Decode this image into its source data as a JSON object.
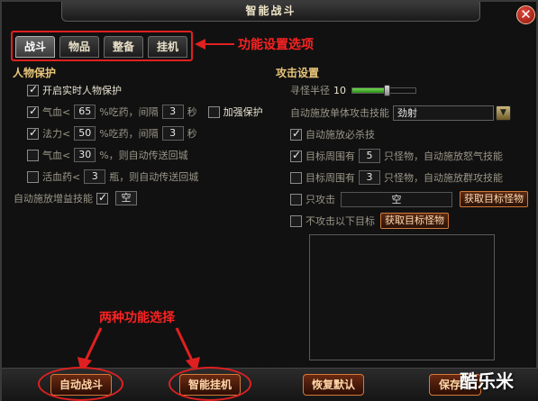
{
  "window": {
    "title": "智能战斗",
    "close_glyph": "✕"
  },
  "tabs": [
    {
      "label": "战斗",
      "active": true
    },
    {
      "label": "物品",
      "active": false
    },
    {
      "label": "整备",
      "active": false
    },
    {
      "label": "挂机",
      "active": false
    }
  ],
  "annotations": {
    "top": "功能设置选项",
    "bottom": "两种功能选择"
  },
  "protection": {
    "title": "人物保护",
    "realtime": {
      "checked": true,
      "label": "开启实时人物保护"
    },
    "hp": {
      "checked": true,
      "prefix": "气血<",
      "value": "65",
      "mid": "%吃药，间隔",
      "interval": "3",
      "unit": "秒"
    },
    "enhance": {
      "checked": false,
      "label": "加强保护"
    },
    "mp": {
      "checked": true,
      "prefix": "法力<",
      "value": "50",
      "mid": "%吃药，间隔",
      "interval": "3",
      "unit": "秒"
    },
    "hp_return": {
      "checked": false,
      "prefix": "气血<",
      "value": "30",
      "suffix": "%，则自动传送回城"
    },
    "potion_return": {
      "checked": false,
      "prefix": "活血药<",
      "value": "3",
      "suffix": "瓶，则自动传送回城"
    },
    "auto_buff": {
      "checked": true,
      "label": "自动施放增益技能",
      "key": "空"
    }
  },
  "attack": {
    "title": "攻击设置",
    "radius": {
      "label": "寻怪半径",
      "value": "10",
      "fraction": 0.55
    },
    "single_skill": {
      "label": "自动施放单体攻击技能",
      "value": "劲射"
    },
    "auto_kill": {
      "checked": true,
      "label": "自动施放必杀技"
    },
    "rage": {
      "checked": true,
      "prefix": "目标周围有",
      "value": "5",
      "suffix": "只怪物，自动施放怒气技能"
    },
    "group": {
      "checked": false,
      "prefix": "目标周围有",
      "value": "3",
      "suffix": "只怪物，自动施放群攻技能"
    },
    "only_attack": {
      "checked": false,
      "label": "只攻击",
      "input": "空",
      "button": "获取目标怪物"
    },
    "no_attack": {
      "checked": false,
      "label": "不攻击以下目标",
      "button": "获取目标怪物"
    }
  },
  "bottom": {
    "auto_fight": "自动战斗",
    "smart_idle": "智能挂机",
    "restore_default": "恢复默认",
    "save": "保存设"
  },
  "watermark": "酷乐米",
  "colors": {
    "accent_red": "#e02020",
    "section_gold": "#e8c67a",
    "button_orange": "#d47a3a"
  }
}
